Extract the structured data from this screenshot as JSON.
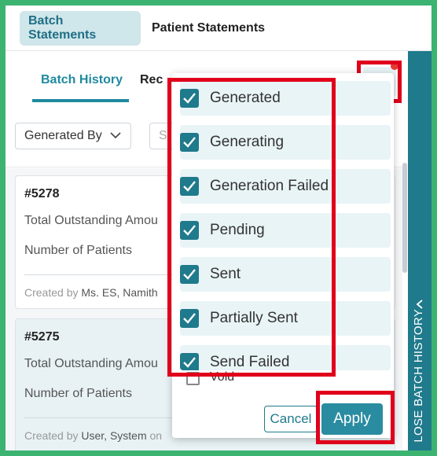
{
  "top_tabs": [
    {
      "label": "Batch Statements",
      "active": true
    },
    {
      "label": "Patient Statements",
      "active": false
    }
  ],
  "sub_tabs": [
    {
      "label": "Batch History",
      "active": true
    },
    {
      "label": "Rec",
      "active": false
    }
  ],
  "filters": {
    "generated_by": "Generated By",
    "search_placeholder": "S"
  },
  "cards": [
    {
      "id": "#5278",
      "outstanding_label": "Total Outstanding Amou",
      "patients_label": "Number of Patients",
      "meta_prefix": "Created by",
      "meta_name": "Ms. ES, Namith",
      "meta_suffix": ""
    },
    {
      "id": "#5275",
      "outstanding_label": "Total Outstanding Amou",
      "patients_label": "Number of Patients",
      "meta_prefix": "Created by",
      "meta_name": "User, System",
      "meta_suffix": "on"
    }
  ],
  "side_panel": {
    "label": "LOSE BATCH HISTORY"
  },
  "status_filter": {
    "options": [
      {
        "label": "Generated",
        "checked": true
      },
      {
        "label": "Generating",
        "checked": true
      },
      {
        "label": "Generation Failed",
        "checked": true
      },
      {
        "label": "Pending",
        "checked": true
      },
      {
        "label": "Sent",
        "checked": true
      },
      {
        "label": "Partially Sent",
        "checked": true
      },
      {
        "label": "Send Failed",
        "checked": true
      }
    ],
    "void_option": {
      "label": "Void",
      "checked": false
    },
    "cancel_label": "Cancel",
    "apply_label": "Apply"
  },
  "colors": {
    "accent": "#1f7a8c",
    "highlight": "#e0001b",
    "frame": "#3cb371",
    "badge": "#e53935"
  }
}
